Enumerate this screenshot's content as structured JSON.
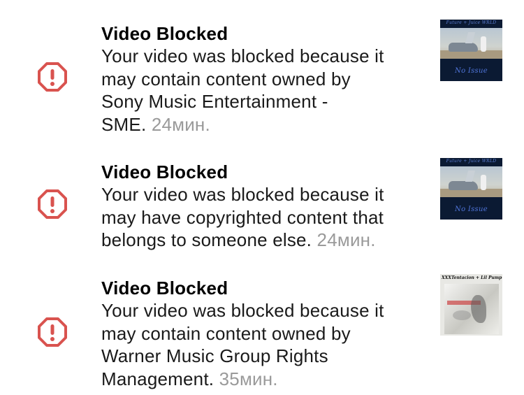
{
  "notifications": [
    {
      "title": "Video Blocked",
      "lines": [
        "Your video was blocked because it",
        "may contain content owned by",
        "Sony Music Entertainment -",
        "SME."
      ],
      "time": "24мин.",
      "icon": "alert-octagon-icon",
      "thumbnail": {
        "top_text": "Future + Juice WRLD",
        "bottom_text": "No Issue"
      }
    },
    {
      "title": "Video Blocked",
      "lines": [
        "Your video was blocked because it",
        "may have copyrighted content that",
        "belongs to someone else."
      ],
      "time": "24мин.",
      "icon": "alert-octagon-icon",
      "thumbnail": {
        "top_text": "Future + Juice WRLD",
        "bottom_text": "No Issue"
      }
    },
    {
      "title": "Video Blocked",
      "lines": [
        "Your video was blocked because it",
        "may contain content owned by",
        "Warner Music Group Rights",
        "Management."
      ],
      "time": "35мин.",
      "icon": "alert-octagon-icon",
      "thumbnail": {
        "top_text": "XXXTentacion + Lil Pump"
      }
    }
  ],
  "colors": {
    "alert_icon": "#d9534f",
    "title": "#000000",
    "message": "#1a1a1a",
    "timestamp": "#9a9a9a"
  }
}
